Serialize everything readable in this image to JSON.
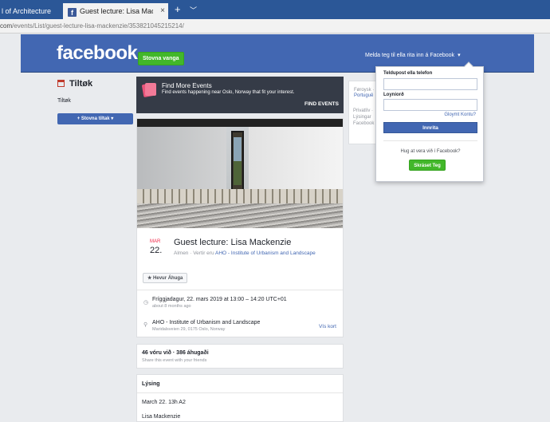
{
  "browser": {
    "tab_inactive": "l of Architecture",
    "tab_active": "Guest lecture: Lisa Macl",
    "tab_close": "×",
    "new_tab": "+",
    "tab_menu": "﹀",
    "url_host": "com",
    "url_path": "/events/List/guest-lecture-lisa-mackenzie/353821045215214/"
  },
  "header": {
    "logo": "facebook",
    "create_page": "Stovna vanga",
    "login_prompt": "Melda teg til ella rita inn á Facebook",
    "caret": "▾"
  },
  "left": {
    "title": "Tiltøk",
    "subtitle": "Tiltøk",
    "create_button": "+ Stovna tiltak ▾"
  },
  "find_events": {
    "title": "Find More Events",
    "subtitle": "Find events happening near Oslo, Norway that fit your interest.",
    "cta": "FIND EVENTS"
  },
  "event": {
    "month": "MAR",
    "day": "22.",
    "title": "Guest lecture: Lisa Mackenzie",
    "meta_prefix": "Almen · Vertir eru ",
    "host": "AHO - Institute of Urbanism and Landscape",
    "interest_button": "★ Hevur Áhuga",
    "time_icon": "◷",
    "time": "Fríggjadagur, 22. mars 2019 at 13:00 – 14:20 UTC+01",
    "time_relative": "about 8 months ago",
    "location_icon": "⚲",
    "location_name": "AHO - Institute of Urbanism and Landscape",
    "location_address": "Maridalsveien 29, 0175 Oslo, Norway",
    "map_link": "Vís kort"
  },
  "stats": {
    "counts": "46 vóru við · 386 áhugaði",
    "share": "Share this event with your friends"
  },
  "description": {
    "heading": "Lýsing",
    "line1": "March 22. 13h A2",
    "line2": "Lisa Mackenzie"
  },
  "right": {
    "line1": "Føroysk ·",
    "line2": "Portuguê",
    "links": [
      "Privatlív ·",
      "Lýsingar",
      "Facebook"
    ]
  },
  "login": {
    "email_label": "Teldupost ella telefon",
    "password_label": "Loyniorð",
    "forgot": "Gloymt Kontu?",
    "login_button": "Innrita",
    "signup_question": "Hug at vera við í Facebook?",
    "signup_button": "Skráset Teg"
  }
}
